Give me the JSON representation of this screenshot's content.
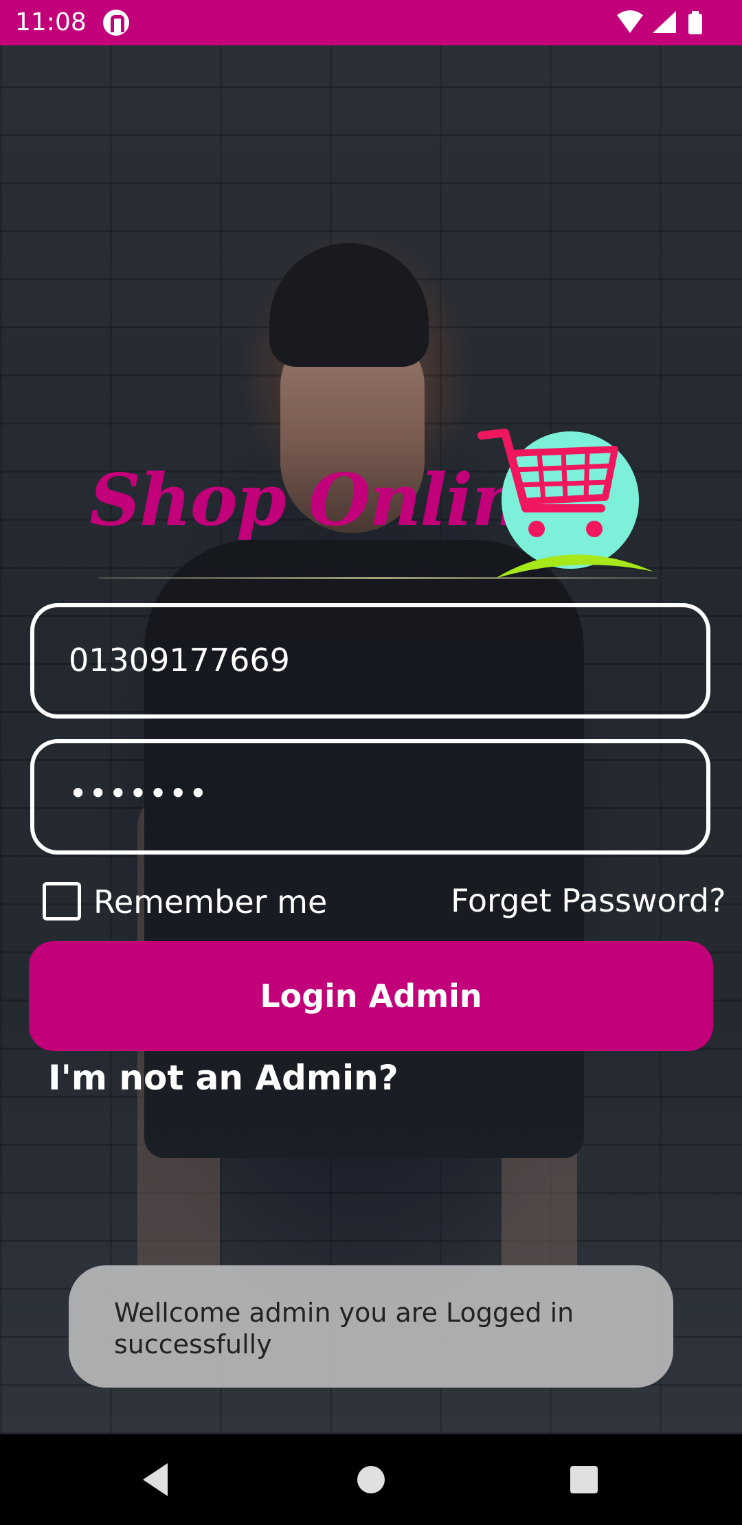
{
  "status_bar": {
    "time": "11:08",
    "app_icon": "pocket-icon",
    "icons": [
      "wifi-icon",
      "signal-icon",
      "battery-icon"
    ]
  },
  "logo": {
    "text": "Shop Online",
    "icon": "shopping-cart-icon"
  },
  "form": {
    "phone_value": "01309177669",
    "password_value": "•••••••",
    "remember_label": "Remember me",
    "remember_checked": false,
    "forgot_label": "Forget Password?",
    "login_label": "Login Admin",
    "not_admin_label": "I'm not an Admin?"
  },
  "toast": {
    "message": "Wellcome admin you are Logged in successfully"
  },
  "nav_bar": {
    "icons": [
      "back-icon",
      "home-icon",
      "recents-icon"
    ]
  },
  "colors": {
    "primary": "#c2007a",
    "logo_circle": "#7cf0d8",
    "logo_swoosh": "#a6e81a"
  }
}
